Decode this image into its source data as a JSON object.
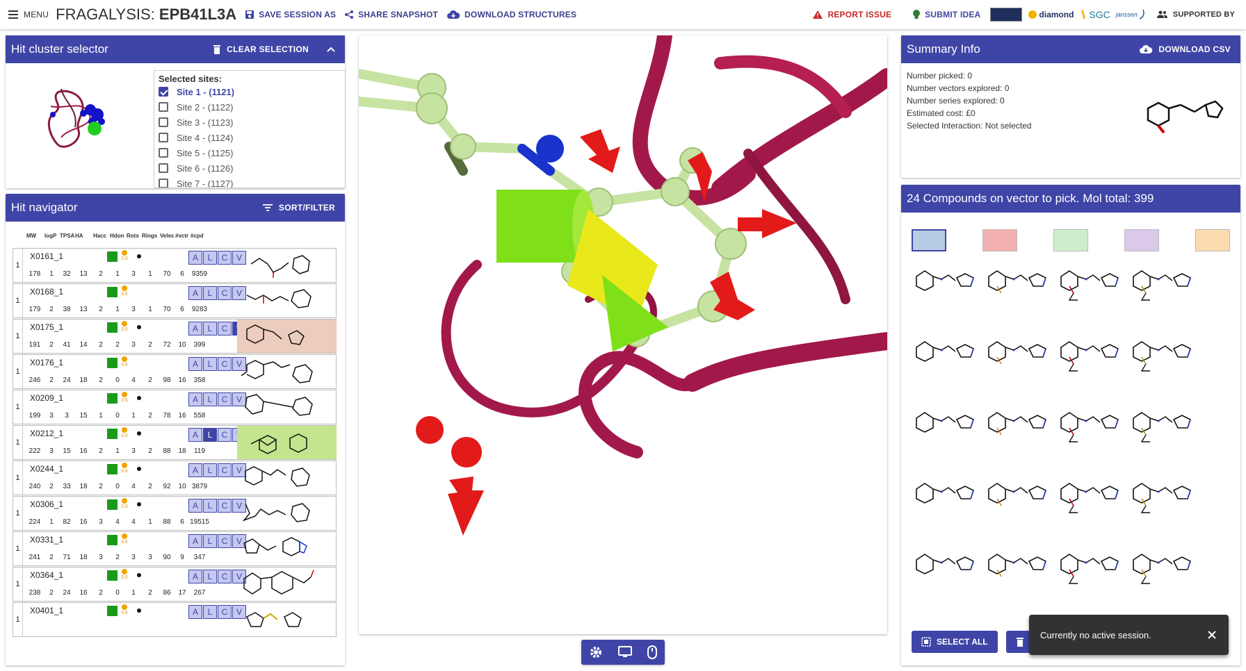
{
  "topbar": {
    "menu_label": "MENU",
    "app_name": "FRAGALYSIS:",
    "target": "EPB41L3A",
    "save_session": "SAVE SESSION AS",
    "share_snapshot": "SHARE SNAPSHOT",
    "download_structures": "DOWNLOAD STRUCTURES",
    "report_issue": "REPORT ISSUE",
    "submit_idea": "SUBMIT IDEA",
    "logos": [
      "diamond",
      "SGC",
      "janssen"
    ],
    "supported_by": "SUPPORTED BY"
  },
  "hit_cluster": {
    "title": "Hit cluster selector",
    "clear_selection": "CLEAR SELECTION",
    "selected_sites_label": "Selected sites:",
    "sites": [
      {
        "label": "Site 1 - (1121)",
        "checked": true
      },
      {
        "label": "Site 2 - (1122)",
        "checked": false
      },
      {
        "label": "Site 3 - (1123)",
        "checked": false
      },
      {
        "label": "Site 4 - (1124)",
        "checked": false
      },
      {
        "label": "Site 5 - (1125)",
        "checked": false
      },
      {
        "label": "Site 6 - (1126)",
        "checked": false
      },
      {
        "label": "Site 7 - (1127)",
        "checked": false
      }
    ]
  },
  "hit_navigator": {
    "title": "Hit navigator",
    "sort_filter": "SORT/FILTER",
    "columns": [
      "MW",
      "logP",
      "TPSA",
      "HA",
      "Hacc",
      "Hdon",
      "Rots",
      "Rings",
      "Velec",
      "#vctr",
      "#cpd"
    ],
    "orange_label": "3.6",
    "alcv": [
      "A",
      "L",
      "C",
      "V"
    ],
    "rows": [
      {
        "num": "1",
        "code": "X0161_1",
        "props": [
          "178",
          "1",
          "32",
          "13",
          "2",
          "1",
          "3",
          "1",
          "70",
          "6",
          "9359"
        ],
        "dot": true,
        "active": "",
        "bg": ""
      },
      {
        "num": "1",
        "code": "X0168_1",
        "props": [
          "179",
          "2",
          "38",
          "13",
          "2",
          "1",
          "3",
          "1",
          "70",
          "6",
          "9283"
        ],
        "dot": false,
        "active": "",
        "bg": ""
      },
      {
        "num": "1",
        "code": "X0175_1",
        "props": [
          "191",
          "2",
          "41",
          "14",
          "2",
          "2",
          "3",
          "2",
          "72",
          "10",
          "399"
        ],
        "dot": true,
        "active": "V",
        "bg": "#ecccbd"
      },
      {
        "num": "1",
        "code": "X0176_1",
        "props": [
          "246",
          "2",
          "24",
          "18",
          "2",
          "0",
          "4",
          "2",
          "98",
          "16",
          "358"
        ],
        "dot": false,
        "active": "",
        "bg": ""
      },
      {
        "num": "1",
        "code": "X0209_1",
        "props": [
          "199",
          "3",
          "3",
          "15",
          "1",
          "0",
          "1",
          "2",
          "78",
          "16",
          "558"
        ],
        "dot": true,
        "active": "",
        "bg": ""
      },
      {
        "num": "1",
        "code": "X0212_1",
        "props": [
          "222",
          "3",
          "15",
          "16",
          "2",
          "1",
          "3",
          "2",
          "88",
          "18",
          "119"
        ],
        "dot": true,
        "active": "L",
        "bg": "#c4e58d"
      },
      {
        "num": "1",
        "code": "X0244_1",
        "props": [
          "240",
          "2",
          "33",
          "18",
          "2",
          "0",
          "4",
          "2",
          "92",
          "10",
          "3879"
        ],
        "dot": true,
        "active": "",
        "bg": ""
      },
      {
        "num": "1",
        "code": "X0306_1",
        "props": [
          "224",
          "1",
          "82",
          "16",
          "3",
          "4",
          "4",
          "1",
          "88",
          "6",
          "19515"
        ],
        "dot": true,
        "active": "",
        "bg": ""
      },
      {
        "num": "1",
        "code": "X0331_1",
        "props": [
          "241",
          "2",
          "71",
          "18",
          "3",
          "2",
          "3",
          "3",
          "90",
          "9",
          "347"
        ],
        "dot": false,
        "active": "",
        "bg": ""
      },
      {
        "num": "1",
        "code": "X0364_1",
        "props": [
          "238",
          "2",
          "24",
          "16",
          "2",
          "0",
          "1",
          "2",
          "86",
          "17",
          "267"
        ],
        "dot": true,
        "active": "",
        "bg": ""
      },
      {
        "num": "1",
        "code": "X0401_1",
        "props": [
          "",
          "",
          "",
          "",
          "",
          "",
          "",
          "",
          "",
          "",
          ""
        ],
        "dot": true,
        "active": "",
        "bg": ""
      }
    ]
  },
  "summary": {
    "title": "Summary Info",
    "download_csv": "DOWNLOAD CSV",
    "lines": [
      "Number picked: 0",
      "Number vectors explored: 0",
      "Number series explored: 0",
      "Estimated cost: £0",
      "Selected Interaction: Not selected"
    ]
  },
  "compounds": {
    "title": "24 Compounds on vector to pick. Mol total: 399",
    "swatches": [
      "#b7cde6",
      "#f3b0b0",
      "#cdeecb",
      "#dac9e8",
      "#fcdbb0"
    ],
    "select_all": "SELECT ALL"
  },
  "toast": {
    "message": "Currently no active session."
  },
  "colors": {
    "primary": "#3f45a6",
    "ribbon": "#a3184a",
    "ligand": "#c7e3a2",
    "arrow_red": "#e31a1a",
    "arrow_green": "#7fe01a"
  }
}
